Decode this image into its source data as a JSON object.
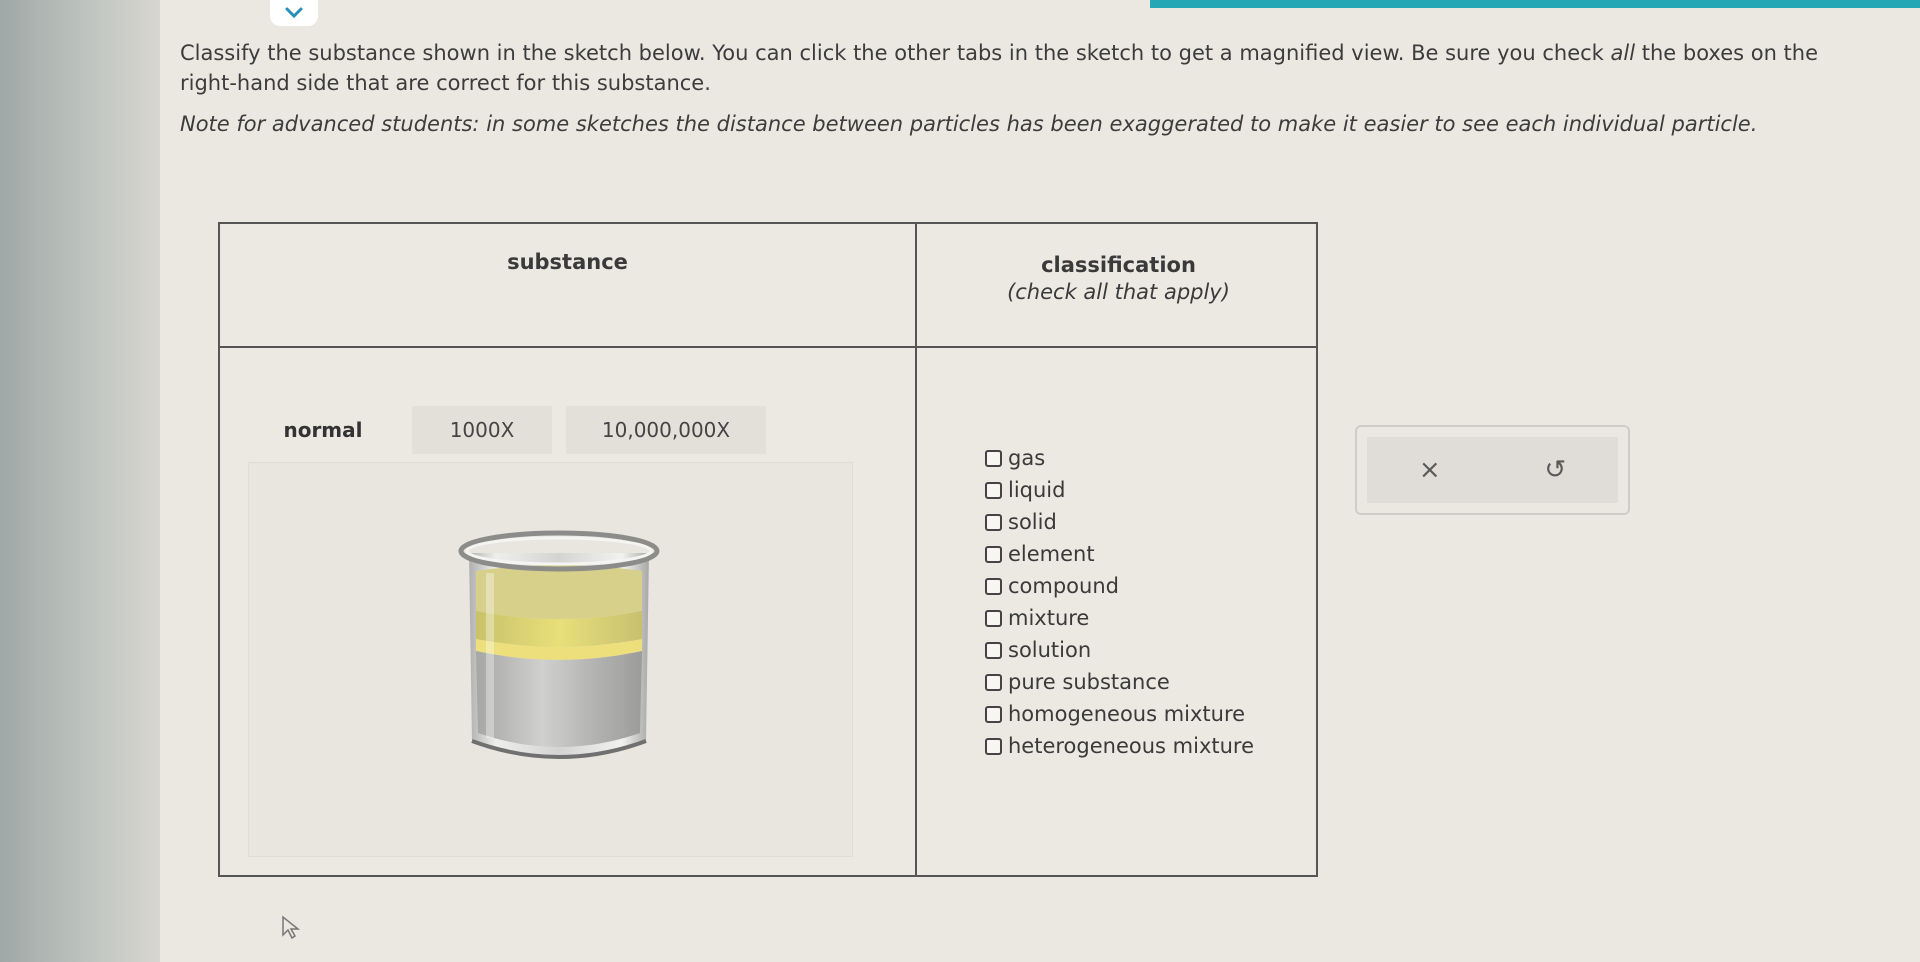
{
  "question": {
    "part1": "Classify the substance shown in the sketch below. You can click the other tabs in the sketch to get a magnified view. Be sure you check ",
    "emphasis": "all",
    "part2": " the boxes on the right-hand side that are correct for this substance.",
    "note_label": "Note for advanced students:",
    "note_body": " in some sketches the distance between particles has been exaggerated to make it easier to see each individual particle."
  },
  "table": {
    "substance_header": "substance",
    "classification_header": "classification",
    "classification_subheader": "(check all that apply)"
  },
  "tabs": [
    {
      "label": "normal",
      "active": true
    },
    {
      "label": "1000X",
      "active": false
    },
    {
      "label": "10,000,000X",
      "active": false
    }
  ],
  "options": [
    {
      "label": "gas",
      "checked": false
    },
    {
      "label": "liquid",
      "checked": false
    },
    {
      "label": "solid",
      "checked": false
    },
    {
      "label": "element",
      "checked": false
    },
    {
      "label": "compound",
      "checked": false
    },
    {
      "label": "mixture",
      "checked": false
    },
    {
      "label": "solution",
      "checked": false
    },
    {
      "label": "pure substance",
      "checked": false
    },
    {
      "label": "homogeneous mixture",
      "checked": false
    },
    {
      "label": "heterogeneous mixture",
      "checked": false
    }
  ],
  "actions": {
    "clear_symbol": "×",
    "reset_symbol": "↺"
  },
  "colors": {
    "accent": "#26a7b6",
    "oil_layer": "#e2d86a",
    "water_layer": "#b8b8b8"
  }
}
